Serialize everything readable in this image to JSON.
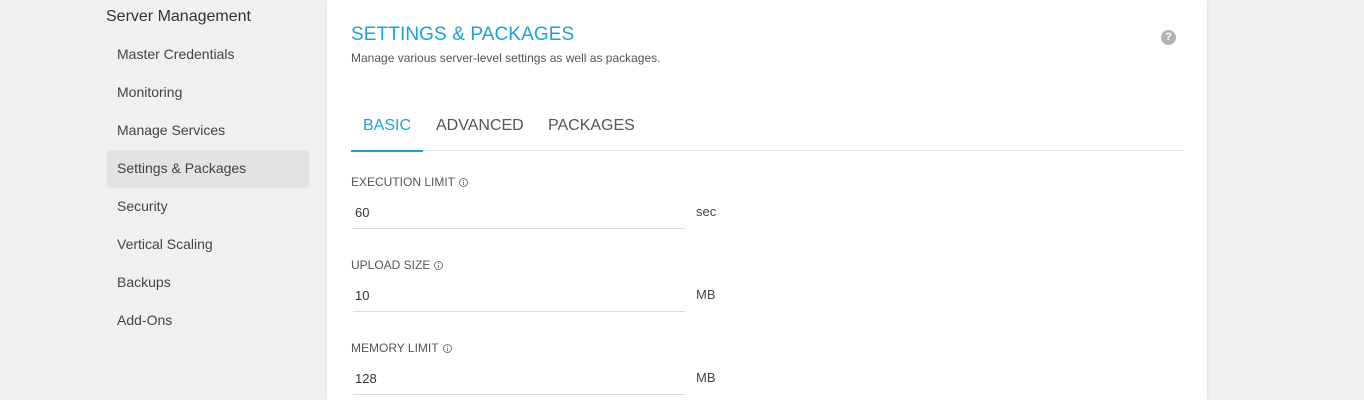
{
  "sidebar": {
    "heading": "Server Management",
    "items": [
      {
        "label": "Master Credentials",
        "active": false
      },
      {
        "label": "Monitoring",
        "active": false
      },
      {
        "label": "Manage Services",
        "active": false
      },
      {
        "label": "Settings & Packages",
        "active": true
      },
      {
        "label": "Security",
        "active": false
      },
      {
        "label": "Vertical Scaling",
        "active": false
      },
      {
        "label": "Backups",
        "active": false
      },
      {
        "label": "Add-Ons",
        "active": false
      }
    ]
  },
  "main": {
    "title": "SETTINGS & PACKAGES",
    "subtitle": "Manage various server-level settings as well as packages.",
    "help_icon": "question-circle-icon",
    "tabs": [
      {
        "label": "BASIC",
        "active": true
      },
      {
        "label": "ADVANCED",
        "active": false
      },
      {
        "label": "PACKAGES",
        "active": false
      }
    ],
    "fields": {
      "execution_limit": {
        "label": "EXECUTION LIMIT",
        "value": "60",
        "unit": "sec",
        "icon": "info-icon"
      },
      "upload_size": {
        "label": "UPLOAD SIZE",
        "value": "10",
        "unit": "MB",
        "icon": "info-icon"
      },
      "memory_limit": {
        "label": "MEMORY LIMIT",
        "value": "128",
        "unit": "MB",
        "icon": "info-icon"
      }
    }
  },
  "colors": {
    "accent": "#1aa3d8",
    "background": "#f0f0f0",
    "active_item": "#e3e3e3"
  }
}
